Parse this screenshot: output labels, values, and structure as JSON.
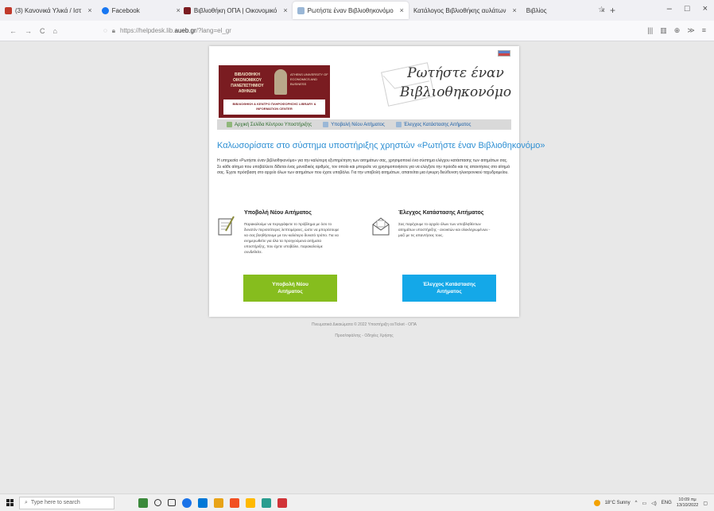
{
  "browser": {
    "tabs": [
      {
        "label": "(3) Κανονικά Υλικά / Ιστ",
        "color": "#c0392b",
        "active": false
      },
      {
        "label": "Facebook",
        "color": "#1877f2",
        "active": false
      },
      {
        "label": "Βιβλιοθήκη ΟΠΑ | Οικονομικό",
        "color": "#7a1c21",
        "active": false
      },
      {
        "label": "Ρωτήστε έναν Βιβλιοθηκονόμο",
        "color": "#9ab7d6",
        "active": true
      },
      {
        "label": "Κατάλογος Βιβλιοθήκης αυλάτων",
        "color": "#999999",
        "active": false
      },
      {
        "label": "Βιβλίος",
        "color": "#999999",
        "active": false
      }
    ],
    "url_prefix": "https://helpdesk.lib.",
    "url_domain": "aueb.gr",
    "url_suffix": "/?lang=el_gr",
    "window_controls": [
      "–",
      "□",
      "×"
    ],
    "nav_buttons": [
      "←",
      "→",
      "C",
      "⌂"
    ],
    "toolbar_icons": [
      "|||",
      "▥",
      "⊕",
      "≫",
      "≡"
    ]
  },
  "page": {
    "logo": {
      "line1": "ΒΙΒΛΙΟΘΗΚΗ ΟΙΚΟΝΟΜΙΚΟΥ ΠΑΝΕΠΙΣΤΗΜΙΟΥ ΑΘΗΝΩΝ",
      "line2": "ATHENS UNIVERSITY OF ECONOMICS AND BUSINESS",
      "band": "ΒΙΒΛΙΟΘΗΚΗ & ΚΕΝΤΡΟ ΠΛΗΡΟΦΟΡΗΣΗΣ LIBRARY & INFORMATION CENTER"
    },
    "site_title": "Ρωτήστε έναν Βιβλιοθηκονόμο",
    "menu": {
      "home": "Αρχική Σελίδα Κέντρου Υποστήριξης",
      "submit": "Υποβολή Νέου Αιτήματος",
      "status": "Έλεγχος Κατάστασης Αιτήματος"
    },
    "welcome": "Καλωσορίσατε στο σύστημα υποστήριξης χρηστών «Ρωτήστε έναν Βιβλιοθηκονόμο»",
    "intro": "Η υπηρεσία «Ρωτήστε έναν βιβλιοθηκονόμο» για την καλύτερη εξυπηρέτηση των αιτημάτων σας, χρησιμοποιεί ένα σύστημα ελέγχου κατάστασης των αιτημάτων σας. Σε κάθε αίτημα που υποβάλλετε δίδεται ένας μοναδικός αριθμός, τον οποίο και μπορείτε να χρησιμοποιήσετε για να ελέγξετε την πρόοδο και τις απαντήσεις στο αίτημά σας. Έχετε πρόσβαση στο αρχείο όλων των αιτημάτων που έχετε υποβάλει. Για την υποβολή αιτημάτων, απαιτείται μια έγκυρη διεύθυνση ηλεκτρονικού ταχυδρομείου.",
    "submit_section": {
      "heading": "Υποβολή Νέου Αιτήματος",
      "text": "Παρακαλούμε να περιγράψετε το πρόβλημα με όσο το δυνατόν περισσότερες λεπτομέρειες, ώστε να μπορέσουμε να σας βοηθήσουμε με τον καλύτερο δυνατό τρόπο. Για να ενημερωθείτε για όλα τα προηγούμενα αιτήματα υποστήριξης, που έχετε υποβάλει, παρακαλούμε συνδεθείτε.",
      "button": "Υποβολή Νέου Αιτήματος"
    },
    "status_section": {
      "heading": "Έλεγχος Κατάστασης Αιτήματος",
      "text": "Σας παρέχουμε το αρχείο όλων των υποβληθέντων αιτημάτων υποστήριξης - ανοικτών και ολοκληρωμένων - μαζί με τις απαντήσεις τους.",
      "button": "Έλεγχος Κατάστασης Αιτήματος"
    },
    "footer_copyright": "Πνευματικά Δικαιώματα © 2022 Υποστήριξη osTicket - ΟΠΑ",
    "footer_links": "Προσ/σφάλτης - Οδηγίες Χρήσης"
  },
  "taskbar": {
    "search_placeholder": "Type here to search",
    "weather": "18°C Sunny",
    "lang": "ENG",
    "time": "10:09 πμ",
    "date": "13/10/2022",
    "app_colors": [
      "#3c8a3c",
      "#1a73e8",
      "#0078d7",
      "#e8a317",
      "#f25022",
      "#ffb900",
      "#2a9d8f",
      "#d13438"
    ]
  }
}
